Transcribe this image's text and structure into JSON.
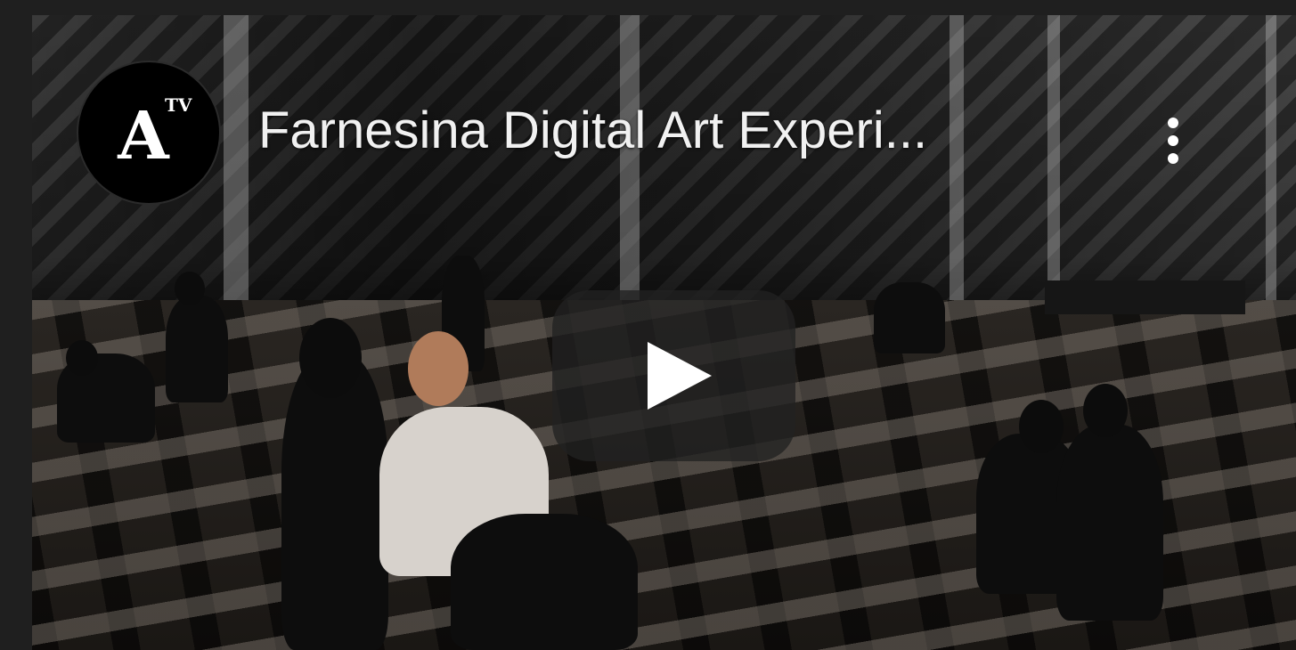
{
  "video": {
    "title": "Farnesina Digital Art Experi...",
    "play_button_color": "#212121"
  },
  "channel": {
    "logo_letter": "A",
    "logo_badge": "TV"
  },
  "controls": {
    "menu_icon": "more-vertical-icon",
    "play_icon": "play-icon"
  }
}
